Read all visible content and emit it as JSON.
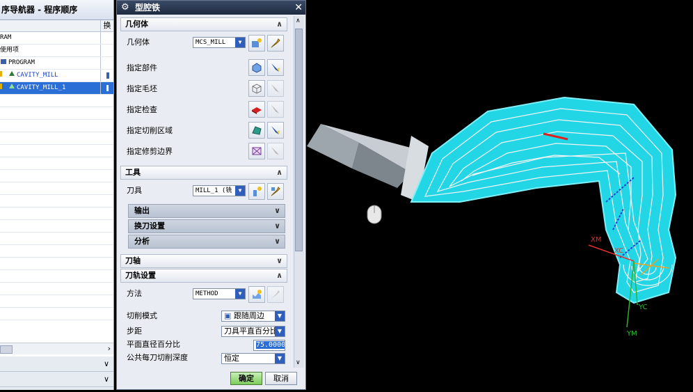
{
  "navigator": {
    "title": "序导航器 - 程序顺序",
    "col2_header": "换",
    "rows": [
      "RAM",
      "使用项",
      "PROGRAM",
      "CAVITY_MILL",
      "CAVITY_MILL_1"
    ]
  },
  "dialog": {
    "title": "型腔铁",
    "geometry": {
      "header": "几何体",
      "geometry_label": "几何体",
      "geometry_value": "MCS_MILL",
      "part_label": "指定部件",
      "blank_label": "指定毛坯",
      "check_label": "指定检查",
      "cut_area_label": "指定切削区域",
      "trim_label": "指定修剪边界"
    },
    "tool": {
      "header": "工具",
      "tool_label": "刀具",
      "tool_value": "MILL_1 (铣",
      "output": "输出",
      "tool_change": "换刀设置",
      "analysis": "分析"
    },
    "axis_header": "刀轴",
    "path": {
      "header": "刀轨设置",
      "method_label": "方法",
      "method_value": "METHOD",
      "cut_pattern_label": "切削模式",
      "cut_pattern_value": "跟随周边",
      "stepover_label": "步距",
      "stepover_value": "刀具平直百分比",
      "percent_label": "平面直径百分比",
      "percent_value": "75.0000",
      "depth_label": "公共每刀切削深度",
      "depth_value": "恒定"
    },
    "ok": "确定",
    "cancel": "取消"
  },
  "viewport": {
    "axis_xm": "XM",
    "axis_xc": "XC",
    "axis_yc": "YC",
    "axis_ym": "YM"
  }
}
